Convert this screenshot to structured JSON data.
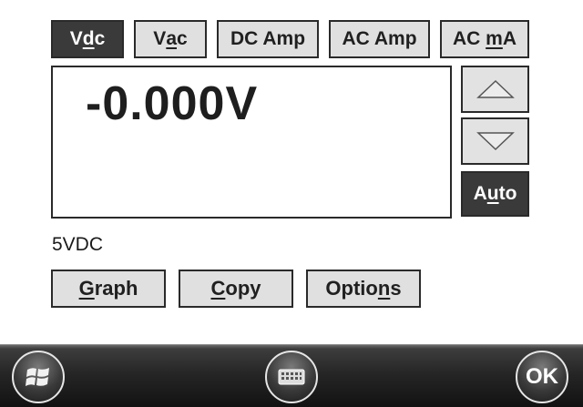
{
  "modes": [
    {
      "id": "vdc",
      "pre": "V",
      "ul": "d",
      "post": "c",
      "active": true
    },
    {
      "id": "vac",
      "pre": "V",
      "ul": "a",
      "post": "c",
      "active": false
    },
    {
      "id": "dc-amp",
      "pre": "DC Amp",
      "ul": "",
      "post": "",
      "active": false
    },
    {
      "id": "ac-amp",
      "pre": "AC Amp",
      "ul": "",
      "post": "",
      "active": false
    },
    {
      "id": "ac-ma",
      "pre": "AC ",
      "ul": "m",
      "post": "A",
      "active": false
    }
  ],
  "display": {
    "reading": "-0.000V"
  },
  "range": {
    "auto_pre": "A",
    "auto_ul": "u",
    "auto_post": "to",
    "label": "5VDC"
  },
  "actions": {
    "graph": {
      "pre": "",
      "ul": "G",
      "post": "raph"
    },
    "copy": {
      "pre": "",
      "ul": "C",
      "post": "opy"
    },
    "options": {
      "pre": "Optio",
      "ul": "n",
      "post": "s"
    }
  },
  "taskbar": {
    "ok_label": "OK"
  },
  "icons": {
    "start": "windows-flag-icon",
    "keyboard": "keyboard-icon",
    "up": "triangle-up-icon",
    "down": "triangle-down-icon"
  }
}
